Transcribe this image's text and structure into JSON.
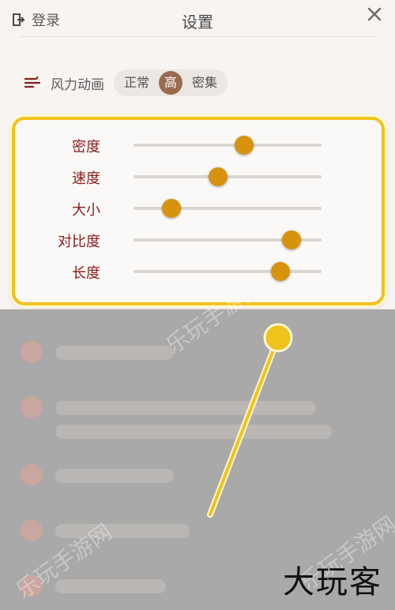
{
  "header": {
    "login_label": "登录",
    "title": "设置"
  },
  "wind_animation": {
    "label": "风力动画",
    "options": [
      "正常",
      "高",
      "密集"
    ],
    "selected": "高"
  },
  "sliders": [
    {
      "label": "密度",
      "value": 0.59
    },
    {
      "label": "速度",
      "value": 0.45
    },
    {
      "label": "大小",
      "value": 0.2
    },
    {
      "label": "对比度",
      "value": 0.84
    },
    {
      "label": "长度",
      "value": 0.78
    }
  ],
  "watermarks": [
    "乐玩手游网",
    "乐玩手游网",
    "乐玩手游网"
  ],
  "brand_mark": "大玩客",
  "colors": {
    "accent_highlight": "#f1c21b",
    "thumb": "#d8930e",
    "label_red": "#8a1c1c",
    "segment_active": "#9a6b4f"
  }
}
